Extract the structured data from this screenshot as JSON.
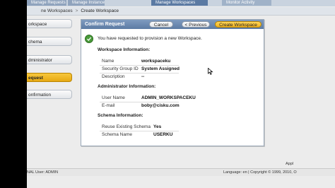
{
  "top_tabs": [
    "Manage Requests",
    "Manage Instance",
    "Manage Workspaces",
    "Monitor Activity"
  ],
  "breadcrumb": {
    "parent": "ne Workspaces",
    "separator": ">",
    "current": "Create Workspace"
  },
  "steps": [
    {
      "label": "orkspace",
      "active": false
    },
    {
      "label": "chema",
      "active": false
    },
    {
      "label": "dministrator",
      "active": false
    },
    {
      "label": "equest",
      "active": true
    },
    {
      "label": "onfirmation",
      "active": false
    }
  ],
  "panel": {
    "title": "Confirm Request",
    "cancel_label": "Cancel",
    "previous_label": "< Previous",
    "create_label": "Create Workspace",
    "message": "You have requested to provision a new Workspace.",
    "workspace_section": "Workspace Information:",
    "workspace": {
      "name_label": "Name",
      "name_value": "workspaceku",
      "sgid_label": "Security Group ID",
      "sgid_value": "System Assigned",
      "desc_label": "Description",
      "desc_value": "--"
    },
    "admin_section": "Administrator Information:",
    "admin": {
      "user_label": "User Name",
      "user_value": "ADMIN_WORKSPACEKU",
      "email_label": "E-mail",
      "email_value": "boby@cisku.com"
    },
    "schema_section": "Schema Information:",
    "schema": {
      "reuse_label": "Reuse Existing Schema",
      "reuse_value": "Yes",
      "name_label": "Schema Name",
      "name_value": "USERKU"
    }
  },
  "apply_text": "Appl",
  "footer": {
    "left": "NAL User: ADMIN",
    "right": "Language: en | Copyright © 1999, 2010, O"
  },
  "colors": {
    "header_blue": "#5c7ba4",
    "accent_yellow": "#f0b320",
    "success_green": "#4a9b3a"
  }
}
